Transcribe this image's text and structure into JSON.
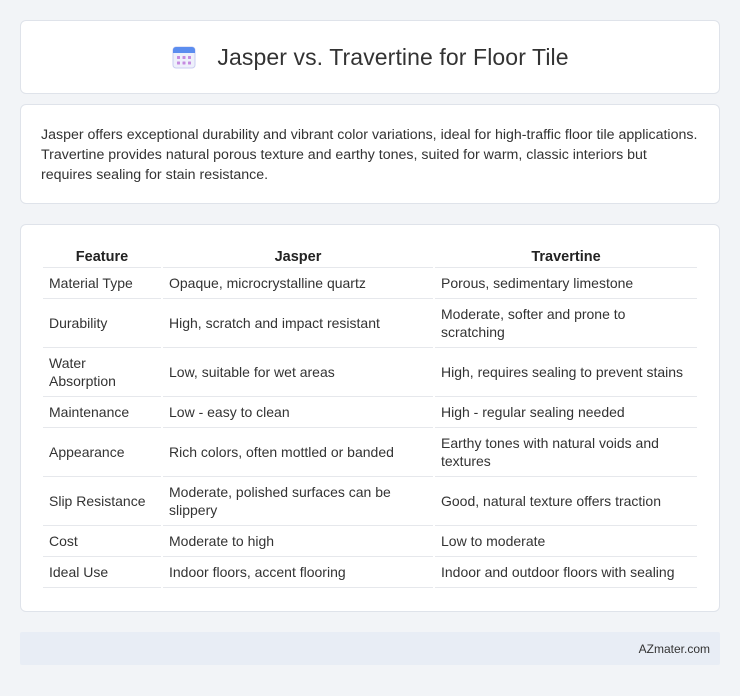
{
  "header": {
    "title": "Jasper vs. Travertine for Floor Tile",
    "icon": "calendar-icon"
  },
  "intro": {
    "text": "Jasper offers exceptional durability and vibrant color variations, ideal for high-traffic floor tile applications. Travertine provides natural porous texture and earthy tones, suited for warm, classic interiors but requires sealing for stain resistance."
  },
  "table": {
    "headers": [
      "Feature",
      "Jasper",
      "Travertine"
    ],
    "rows": [
      [
        "Material Type",
        "Opaque, microcrystalline quartz",
        "Porous, sedimentary limestone"
      ],
      [
        "Durability",
        "High, scratch and impact resistant",
        "Moderate, softer and prone to scratching"
      ],
      [
        "Water Absorption",
        "Low, suitable for wet areas",
        "High, requires sealing to prevent stains"
      ],
      [
        "Maintenance",
        "Low - easy to clean",
        "High - regular sealing needed"
      ],
      [
        "Appearance",
        "Rich colors, often mottled or banded",
        "Earthy tones with natural voids and textures"
      ],
      [
        "Slip Resistance",
        "Moderate, polished surfaces can be slippery",
        "Good, natural texture offers traction"
      ],
      [
        "Cost",
        "Moderate to high",
        "Low to moderate"
      ],
      [
        "Ideal Use",
        "Indoor floors, accent flooring",
        "Indoor and outdoor floors with sealing"
      ]
    ]
  },
  "footer": {
    "brand": "AZmater.com"
  }
}
